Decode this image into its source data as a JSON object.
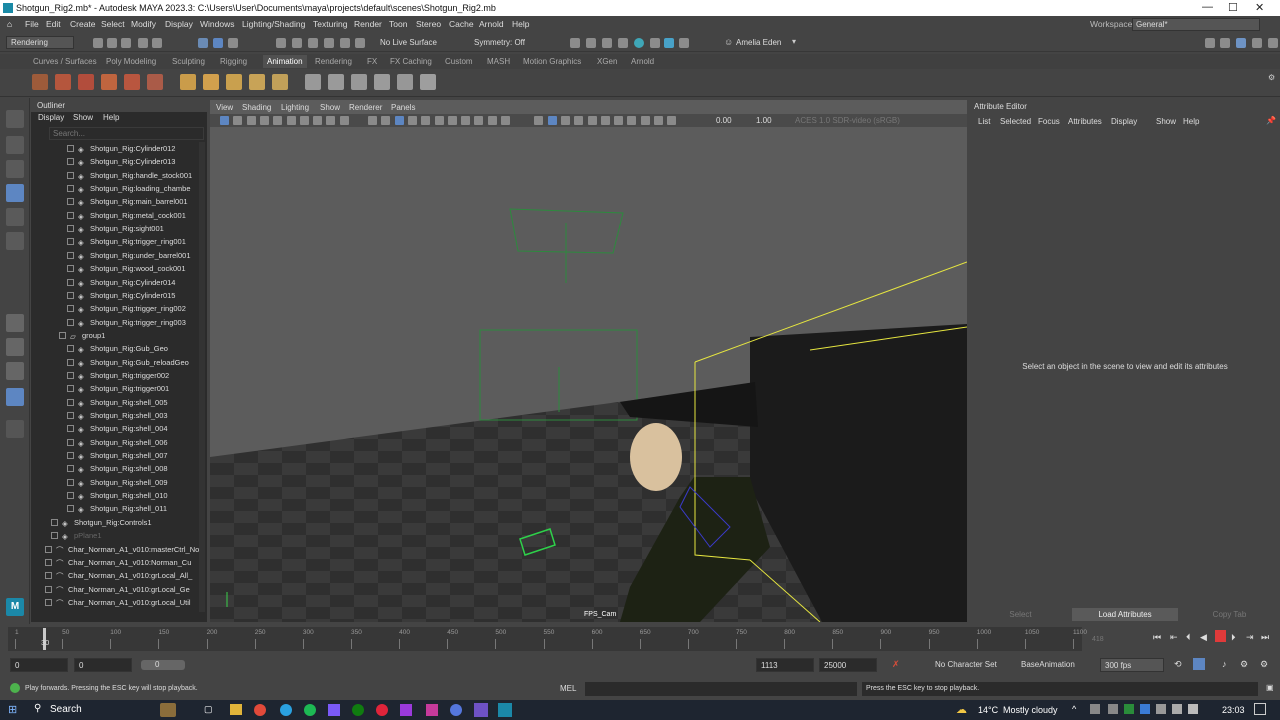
{
  "window": {
    "title": "Shotgun_Rig2.mb* - Autodesk MAYA 2023.3: C:\\Users\\User\\Documents\\maya\\projects\\default\\scenes\\Shotgun_Rig2.mb",
    "min": "—",
    "max": "☐",
    "close": "✕"
  },
  "menu": [
    "File",
    "Edit",
    "Create",
    "Select",
    "Modify",
    "Display",
    "Windows",
    "Lighting/Shading",
    "Texturing",
    "Render",
    "Toon",
    "Stereo",
    "Cache",
    "Arnold",
    "Help"
  ],
  "workspace": {
    "label": "Workspace:",
    "value": "General*"
  },
  "statusline": {
    "menuset": "Rendering",
    "live_surface": "No Live Surface",
    "symmetry": "Symmetry: Off",
    "user": "Amelia Eden"
  },
  "shelf_tabs": [
    "Curves / Surfaces",
    "Poly Modeling",
    "Sculpting",
    "Rigging",
    "Animation",
    "Rendering",
    "FX",
    "FX Caching",
    "Custom",
    "MASH",
    "Motion Graphics",
    "XGen",
    "Arnold"
  ],
  "shelf_active": "Animation",
  "outliner": {
    "title": "Outliner",
    "menu": [
      "Display",
      "Show",
      "Help"
    ],
    "search_placeholder": "Search...",
    "rows": [
      {
        "t": "Shotgun_Rig:Cylinder012",
        "i": 1
      },
      {
        "t": "Shotgun_Rig:Cylinder013",
        "i": 1
      },
      {
        "t": "Shotgun_Rig:handle_stock001",
        "i": 1
      },
      {
        "t": "Shotgun_Rig:loading_chambe",
        "i": 1
      },
      {
        "t": "Shotgun_Rig:main_barrel001",
        "i": 1
      },
      {
        "t": "Shotgun_Rig:metal_cock001",
        "i": 1
      },
      {
        "t": "Shotgun_Rig:sight001",
        "i": 1
      },
      {
        "t": "Shotgun_Rig:trigger_ring001",
        "i": 1
      },
      {
        "t": "Shotgun_Rig:under_barrel001",
        "i": 1
      },
      {
        "t": "Shotgun_Rig:wood_cock001",
        "i": 1
      },
      {
        "t": "Shotgun_Rig:Cylinder014",
        "i": 1
      },
      {
        "t": "Shotgun_Rig:Cylinder015",
        "i": 1
      },
      {
        "t": "Shotgun_Rig:trigger_ring002",
        "i": 1
      },
      {
        "t": "Shotgun_Rig:trigger_ring003",
        "i": 1
      },
      {
        "t": "group1",
        "i": 0
      },
      {
        "t": "Shotgun_Rig:Gub_Geo",
        "i": 1
      },
      {
        "t": "Shotgun_Rig:Gub_reloadGeo",
        "i": 1
      },
      {
        "t": "Shotgun_Rig:trigger002",
        "i": 1
      },
      {
        "t": "Shotgun_Rig:trigger001",
        "i": 1
      },
      {
        "t": "Shotgun_Rig:shell_005",
        "i": 1
      },
      {
        "t": "Shotgun_Rig:shell_003",
        "i": 1
      },
      {
        "t": "Shotgun_Rig:shell_004",
        "i": 1
      },
      {
        "t": "Shotgun_Rig:shell_006",
        "i": 1
      },
      {
        "t": "Shotgun_Rig:shell_007",
        "i": 1
      },
      {
        "t": "Shotgun_Rig:shell_008",
        "i": 1
      },
      {
        "t": "Shotgun_Rig:shell_009",
        "i": 1
      },
      {
        "t": "Shotgun_Rig:shell_010",
        "i": 1
      },
      {
        "t": "Shotgun_Rig:shell_011",
        "i": 1
      },
      {
        "t": "Shotgun_Rig:Controls1",
        "i": -1
      },
      {
        "t": "pPlane1",
        "i": -1,
        "dim": true
      },
      {
        "t": "Char_Norman_A1_v010:masterCtrl_No",
        "i": -2
      },
      {
        "t": "Char_Norman_A1_v010:Norman_Cu",
        "i": -2
      },
      {
        "t": "Char_Norman_A1_v010:grLocal_All_",
        "i": -2
      },
      {
        "t": "Char_Norman_A1_v010:grLocal_Ge",
        "i": -2
      },
      {
        "t": "Char_Norman_A1_v010:grLocal_Util",
        "i": -2
      }
    ]
  },
  "viewport": {
    "menu": [
      "View",
      "Shading",
      "Lighting",
      "Show",
      "Renderer",
      "Panels"
    ],
    "exposure": "0.00",
    "gamma": "1.00",
    "colorspace": "ACES 1.0 SDR-video (sRGB)",
    "camera": "FPS_Cam"
  },
  "attr_editor": {
    "title": "Attribute Editor",
    "menu": [
      "List",
      "Selected",
      "Focus",
      "Attributes",
      "Display",
      "Show",
      "Help"
    ],
    "message": "Select an object in the scene to view and edit its attributes",
    "select": "Select",
    "load": "Load Attributes",
    "copy_tab": "Copy Tab"
  },
  "timeline": {
    "ticks": [
      "1",
      "50",
      "100",
      "150",
      "200",
      "250",
      "300",
      "350",
      "400",
      "450",
      "500",
      "550",
      "600",
      "650",
      "700",
      "750",
      "800",
      "850",
      "900",
      "950",
      "1000",
      "1050",
      "1100"
    ],
    "current": "30",
    "end_label": "418"
  },
  "range": {
    "start": "0",
    "inner_start": "0",
    "slider_val": "0",
    "inner_end": "1113",
    "end": "25000",
    "char_set": "No Character Set",
    "anim_layer": "BaseAnimation",
    "fps": "300 fps"
  },
  "cmdline": {
    "feedback": "Play forwards. Pressing the ESC key will stop playback.",
    "lang": "MEL",
    "help": "Press the ESC key to stop playback."
  },
  "taskbar": {
    "search": "Search",
    "weather_temp": "14°C",
    "weather": "Mostly cloudy",
    "time": "23:03"
  }
}
